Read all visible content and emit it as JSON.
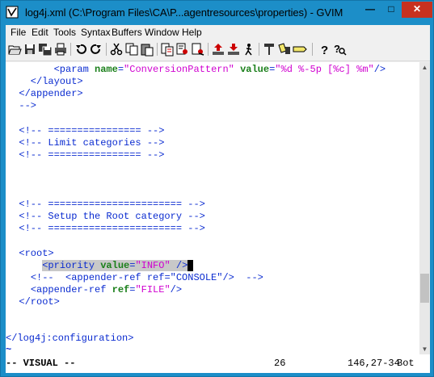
{
  "window": {
    "title": "log4j.xml (C:\\Program Files\\CA\\P...agentresources\\properties) - GVIM",
    "min_glyph": "—",
    "max_glyph": "□",
    "close_glyph": "✕"
  },
  "menu": [
    "File",
    "Edit",
    "Tools",
    "Syntax",
    "Buffers",
    "Window",
    "Help"
  ],
  "toolbar": [
    "open-icon",
    "save-icon",
    "save-all-icon",
    "print-icon",
    "undo-icon",
    "redo-icon",
    "cut-icon",
    "copy-icon",
    "paste-icon",
    "replace-icon",
    "find-next-icon",
    "find-prev-icon",
    "load-session-icon",
    "save-session-icon",
    "run-script-icon",
    "make-icon",
    "run-ctags-icon",
    "tag-jump-icon",
    "help-icon",
    "find-help-icon"
  ],
  "editor": {
    "l1": {
      "indent": "        ",
      "open": "<param ",
      "a1": "name",
      "eq1": "=",
      "v1": "\"ConversionPattern\"",
      "sp": " ",
      "a2": "value",
      "eq2": "=",
      "v2": "\"%d %-5p [%c] %m\"",
      "close": "/>"
    },
    "l2": "    </layout>",
    "l3": "  </appender>",
    "l4": "  -->",
    "l5": "  <!-- ================ -->",
    "l6": "  <!-- Limit categories -->",
    "l7": "  <!-- ================ -->",
    "l8": "  <!-- ======================= -->",
    "l9": "  <!-- Setup the Root category -->",
    "l10": "  <!-- ======================= -->",
    "l11": "  <root>",
    "l12": {
      "indent": "      ",
      "open": "<priority ",
      "a1": "value",
      "eq1": "=",
      "v1": "\"INFO\"",
      "close": " />",
      "cursor": " "
    },
    "l13": {
      "indent": "    ",
      "text": "<!--  <appender-ref ref=\"CONSOLE\"/>  -->"
    },
    "l14": {
      "indent": "    ",
      "open": "<appender-ref ",
      "a1": "ref",
      "eq1": "=",
      "v1": "\"FILE\"",
      "close": "/>"
    },
    "l15": "  </root>",
    "l16": "</log4j:configuration>",
    "tilde": "~"
  },
  "status": {
    "mode": "-- VISUAL --",
    "selected": "26",
    "position": "146,27-34",
    "scroll": "Bot"
  }
}
